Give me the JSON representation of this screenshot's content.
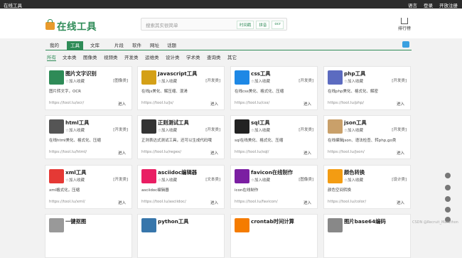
{
  "topbar": {
    "brand": "在线工具",
    "lang": "语言",
    "login": "登录",
    "register": "开放注册"
  },
  "logo": {
    "text": "在线工具"
  },
  "search": {
    "placeholder": "搜索其实很简单",
    "tags": [
      "时间戳",
      "拼音",
      "ocr"
    ]
  },
  "rank": {
    "label": "排行榜"
  },
  "nav_tabs": [
    "我的",
    "工具",
    "文库",
    "片段",
    "软件",
    "网址",
    "话题"
  ],
  "categories": [
    "所有",
    "文本类",
    "图像类",
    "视频类",
    "开发类",
    "运维类",
    "设计类",
    "学术类",
    "查询类",
    "其它"
  ],
  "cards": [
    {
      "title": "图片文字识别",
      "fav": "加入收藏",
      "badge": "[图像类]",
      "desc": "图片转文字，OCR",
      "url": "https://tool.lu/ocr/",
      "enter": "进入",
      "icon": "ocr-icon"
    },
    {
      "title": "Javascript工具",
      "fav": "加入收藏",
      "badge": "[开发类]",
      "desc": "在线js美化、解压缩、混淆",
      "url": "https://tool.lu/js/",
      "enter": "进入",
      "icon": "js-file-icon"
    },
    {
      "title": "css工具",
      "fav": "加入收藏",
      "badge": "[开发类]",
      "desc": "在线css美化、格式化、压缩",
      "url": "https://tool.lu/css/",
      "enter": "进入",
      "icon": "css-file-icon"
    },
    {
      "title": "php工具",
      "fav": "加入收藏",
      "badge": "[开发类]",
      "desc": "在线php美化、格式化、解密",
      "url": "https://tool.lu/php/",
      "enter": "进入",
      "icon": "php-file-icon"
    },
    {
      "title": "html工具",
      "fav": "加入收藏",
      "badge": "[开发类]",
      "desc": "在线html美化、格式化、压缩",
      "url": "https://tool.lu/html/",
      "enter": "进入",
      "icon": "html-icon"
    },
    {
      "title": "正则测试工具",
      "fav": "加入收藏",
      "badge": "[开发类]",
      "desc": "正则表达式测试工具，还可以生成代码哦",
      "url": "https://tool.lu/regex/",
      "enter": "进入",
      "icon": "regex-icon"
    },
    {
      "title": "sql工具",
      "fav": "加入收藏",
      "badge": "[开发类]",
      "desc": "sql在线美化、格式化、压缩",
      "url": "https://tool.lu/sql/",
      "enter": "进入",
      "icon": "sql-icon"
    },
    {
      "title": "json工具",
      "fav": "加入收藏",
      "badge": "[开发类]",
      "desc": "在线编辑json、语法检查、转php,go类",
      "url": "https://tool.lu/json/",
      "enter": "进入",
      "icon": "json-file-icon"
    },
    {
      "title": "xml工具",
      "fav": "加入收藏",
      "badge": "[开发类]",
      "desc": "xml格式化，压缩",
      "url": "https://tool.lu/xml/",
      "enter": "进入",
      "icon": "xml-icon"
    },
    {
      "title": "asciidoc编辑器",
      "fav": "加入收藏",
      "badge": "[文本类]",
      "desc": "asciidoc编辑器",
      "url": "https://tool.lu/asciidoc/",
      "enter": "进入",
      "icon": "asciidoc-icon"
    },
    {
      "title": "favicon在线制作",
      "fav": "加入收藏",
      "badge": "[图像类]",
      "desc": "icon在线制作",
      "url": "https://tool.lu/favicon/",
      "enter": "进入",
      "icon": "favicon-icon"
    },
    {
      "title": "颜色转换",
      "fav": "加入收藏",
      "badge": "[设计类]",
      "desc": "颜色空间转换",
      "url": "https://tool.lu/color/",
      "enter": "进入",
      "icon": "color-icon"
    },
    {
      "title": "一键抠图",
      "fav": "",
      "badge": "",
      "desc": "",
      "url": "",
      "enter": "",
      "icon": "cutout-icon"
    },
    {
      "title": "python工具",
      "fav": "",
      "badge": "",
      "desc": "",
      "url": "",
      "enter": "",
      "icon": "python-icon"
    },
    {
      "title": "crontab时间计算",
      "fav": "",
      "badge": "",
      "desc": "",
      "url": "",
      "enter": "",
      "icon": "crontab-icon"
    },
    {
      "title": "图片base64编码",
      "fav": "",
      "badge": "",
      "desc": "",
      "url": "",
      "enter": "",
      "icon": "base64-icon"
    }
  ],
  "watermark": "CSDN @Recruit_Marathon"
}
